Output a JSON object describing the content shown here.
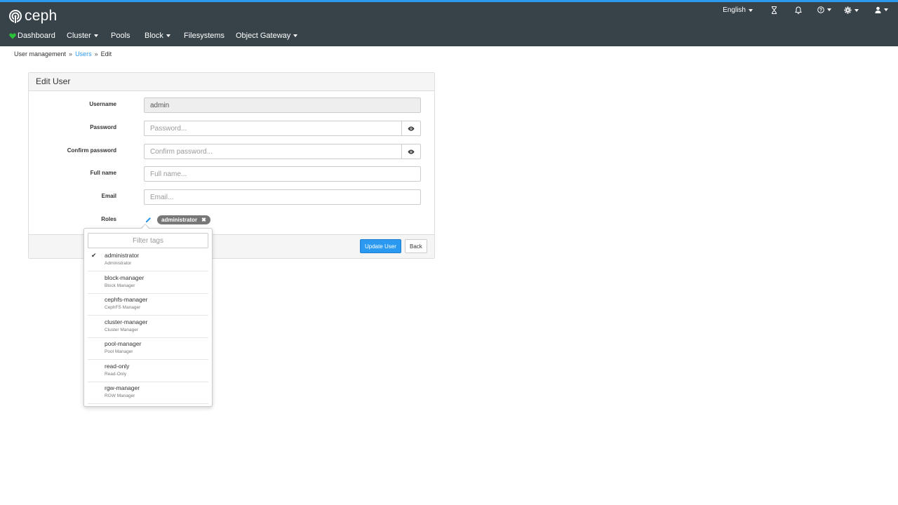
{
  "brand": {
    "name": "ceph"
  },
  "utility": {
    "language": "English",
    "icons": [
      "hourglass-icon",
      "bell-icon",
      "help-icon",
      "gear-icon",
      "user-icon"
    ]
  },
  "nav": {
    "dashboard": "Dashboard",
    "cluster": "Cluster",
    "pools": "Pools",
    "block": "Block",
    "filesystems": "Filesystems",
    "object_gateway": "Object Gateway"
  },
  "breadcrumb": {
    "root": "User management",
    "users": "Users",
    "current": "Edit"
  },
  "form": {
    "title": "Edit User",
    "username_label": "Username",
    "username_value": "admin",
    "password_label": "Password",
    "password_placeholder": "Password...",
    "confirm_label": "Confirm password",
    "confirm_placeholder": "Confirm password...",
    "fullname_label": "Full name",
    "fullname_placeholder": "Full name...",
    "email_label": "Email",
    "email_placeholder": "Email...",
    "roles_label": "Roles",
    "selected_role": "administrator",
    "update_button": "Update User",
    "back_button": "Back"
  },
  "dropdown": {
    "filter_placeholder": "Filter tags",
    "items": [
      {
        "name": "administrator",
        "desc": "Administrator",
        "checked": true
      },
      {
        "name": "block-manager",
        "desc": "Block Manager",
        "checked": false
      },
      {
        "name": "cephfs-manager",
        "desc": "CephFS Manager",
        "checked": false
      },
      {
        "name": "cluster-manager",
        "desc": "Cluster Manager",
        "checked": false
      },
      {
        "name": "pool-manager",
        "desc": "Pool Manager",
        "checked": false
      },
      {
        "name": "read-only",
        "desc": "Read-Only",
        "checked": false
      },
      {
        "name": "rgw-manager",
        "desc": "RGW Manager",
        "checked": false
      }
    ]
  },
  "colors": {
    "topbar": "#374249",
    "accent": "#2b99f0",
    "health_ok": "#2bbf3a",
    "tag": "#777777"
  }
}
